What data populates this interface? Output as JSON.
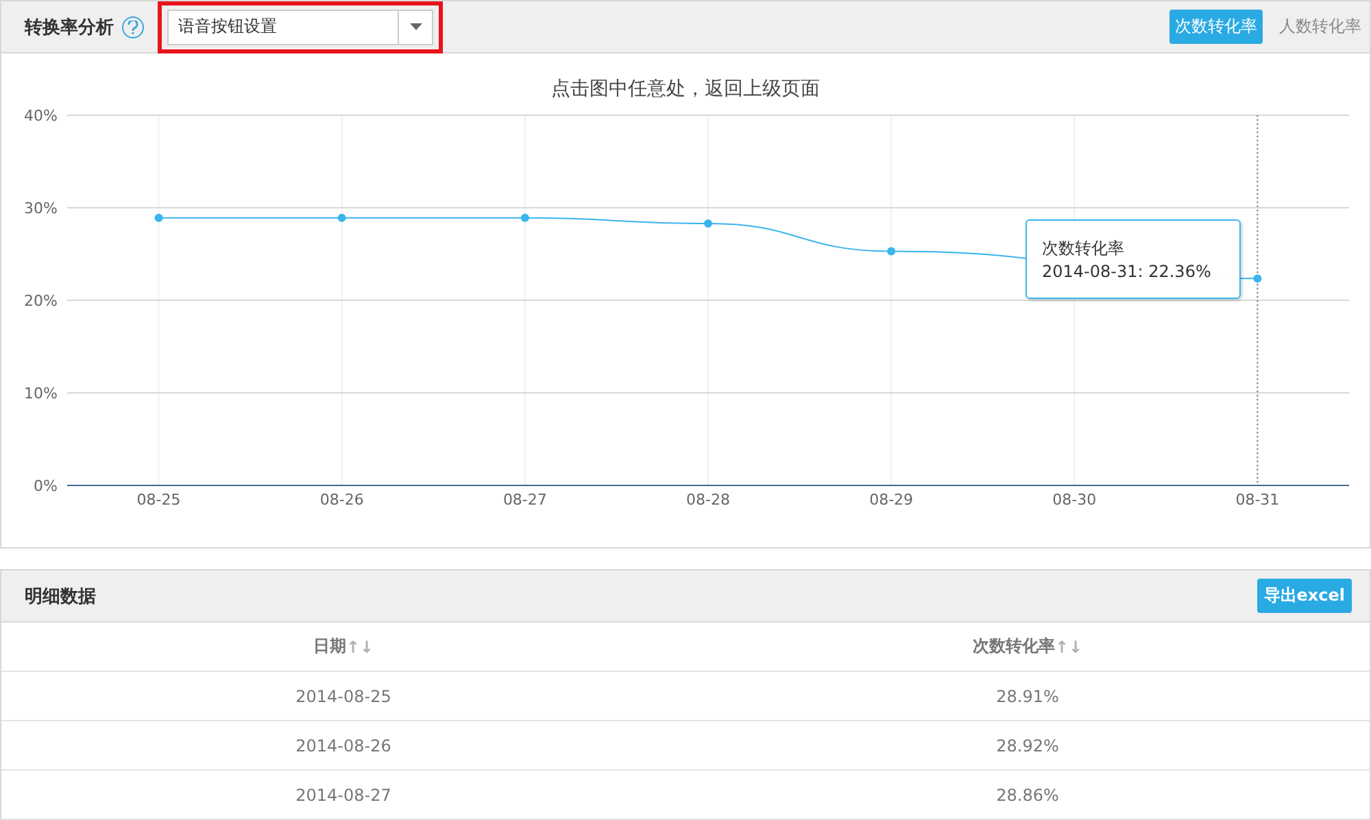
{
  "chart_panel": {
    "title": "转换率分析",
    "dropdown": {
      "value": "语音按钮设置",
      "highlighted": true
    },
    "tabs": [
      {
        "label": "次数转化率",
        "selected": true
      },
      {
        "label": "人数转化率",
        "selected": false
      }
    ],
    "chart_data": {
      "type": "line",
      "title": "点击图中任意处，返回上级页面",
      "categories": [
        "08-25",
        "08-26",
        "08-27",
        "08-28",
        "08-29",
        "08-30",
        "08-31"
      ],
      "ylim": [
        0,
        40
      ],
      "yticks": [
        {
          "value": 0,
          "label": "0%"
        },
        {
          "value": 10,
          "label": "10%"
        },
        {
          "value": 20,
          "label": "20%"
        },
        {
          "value": 30,
          "label": "30%"
        },
        {
          "value": 40,
          "label": "40%"
        }
      ],
      "grid": true,
      "ref_lines": [
        {
          "axis": "x",
          "value": "08-31"
        }
      ],
      "series": [
        {
          "name": "次数转化率",
          "color": "#3ab4ec",
          "marker": true,
          "values": [
            28.9,
            28.9,
            28.9,
            28.3,
            25.3,
            null,
            22.36
          ]
        }
      ]
    },
    "tooltip": {
      "line": "2014-08-31: 22.36%"
    }
  },
  "detail_panel": {
    "title": "明细数据",
    "export_button": "导出excel",
    "columns": [
      "日期",
      "次数转化率"
    ],
    "sort_icon": "↑↓",
    "rows": [
      [
        "2014-08-25",
        "28.91%"
      ],
      [
        "2014-08-26",
        "28.92%"
      ],
      [
        "2014-08-27",
        "28.86%"
      ]
    ]
  }
}
